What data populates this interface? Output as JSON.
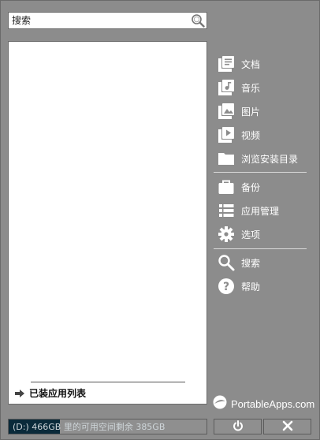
{
  "search": {
    "placeholder": "搜索",
    "value": ""
  },
  "app_list": {
    "installed_label": "已装应用列表"
  },
  "menu": {
    "documents": "文档",
    "music": "音乐",
    "pictures": "图片",
    "videos": "视频",
    "browse": "浏览安装目录",
    "backup": "备份",
    "app_manage": "应用管理",
    "options": "选项",
    "search": "搜索",
    "help": "帮助"
  },
  "brand": {
    "name": "PortableApps.com"
  },
  "storage": {
    "text": "(D:) 466GB 里的可用空间剩余 385GB",
    "used_fraction": 0.26
  },
  "colors": {
    "panel_bg": "#8c8c8c",
    "storage_fill": "#0a2a3a"
  }
}
